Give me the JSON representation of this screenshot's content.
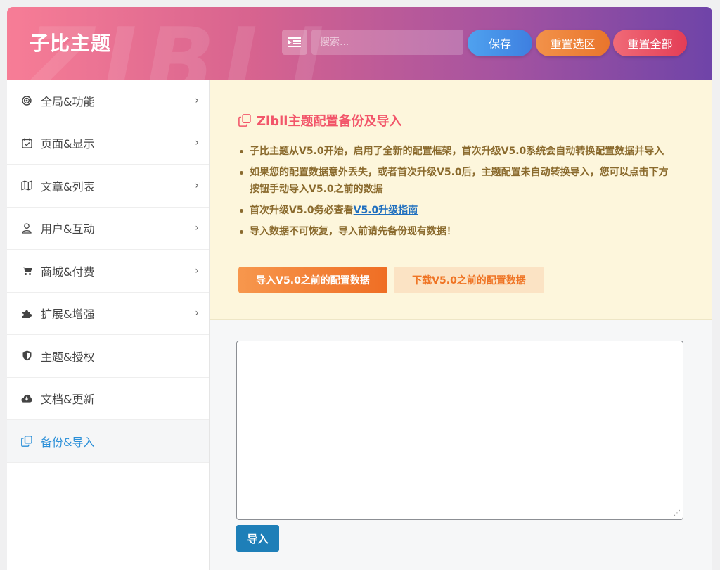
{
  "header": {
    "logo": "子比主题",
    "watermark": "ZIBLL",
    "search_placeholder": "搜索...",
    "save_label": "保存",
    "reset_section_label": "重置选区",
    "reset_all_label": "重置全部"
  },
  "sidebar": {
    "items": [
      {
        "label": "全局&功能",
        "icon": "target-icon",
        "has_chevron": true
      },
      {
        "label": "页面&显示",
        "icon": "calendar-check-icon",
        "has_chevron": true
      },
      {
        "label": "文章&列表",
        "icon": "map-icon",
        "has_chevron": true
      },
      {
        "label": "用户&互动",
        "icon": "user-icon",
        "has_chevron": true
      },
      {
        "label": "商城&付费",
        "icon": "cart-icon",
        "has_chevron": true
      },
      {
        "label": "扩展&增强",
        "icon": "puzzle-icon",
        "has_chevron": true
      },
      {
        "label": "主题&授权",
        "icon": "shield-icon",
        "has_chevron": false
      },
      {
        "label": "文档&更新",
        "icon": "cloud-download-icon",
        "has_chevron": false
      },
      {
        "label": "备份&导入",
        "icon": "copy-icon",
        "has_chevron": false,
        "active": true
      }
    ]
  },
  "notice": {
    "title": "Zibll主题配置备份及导入",
    "items": [
      "子比主题从V5.0开始，启用了全新的配置框架，首次升级V5.0系统会自动转换配置数据并导入",
      "如果您的配置数据意外丢失，或者首次升级V5.0后，主题配置未自动转换导入，您可以点击下方按钮手动导入V5.0之前的数据"
    ],
    "item3_prefix": "首次升级V5.0务必查看",
    "item3_link": "V5.0升级指南",
    "item4": "导入数据不可恢复，导入前请先备份现有数据！",
    "import_old_label": "导入V5.0之前的配置数据",
    "download_old_label": "下载V5.0之前的配置数据"
  },
  "import": {
    "textarea_value": "",
    "button_label": "导入"
  },
  "colors": {
    "accent_blue": "#2a8fd8",
    "notice_title": "#f2566a",
    "notice_text": "#8a6a2d",
    "import_button": "#1e7fb8"
  }
}
